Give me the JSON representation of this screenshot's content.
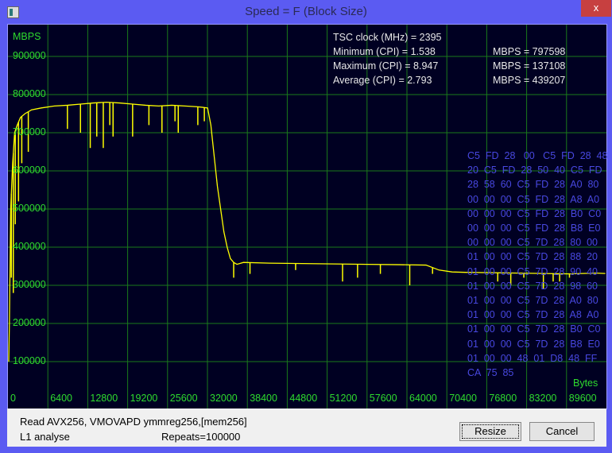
{
  "window": {
    "title": "Speed = F (Block Size)",
    "close_label": "x"
  },
  "chart_data": {
    "type": "line",
    "title": "Speed = F (Block Size)",
    "ylabel": "MBPS",
    "xlabel": "Bytes",
    "ylim": [
      0,
      1000000
    ],
    "xlim": [
      0,
      92000
    ],
    "yticks": [
      "900000",
      "800000",
      "700000",
      "600000",
      "500000",
      "400000",
      "300000",
      "200000",
      "100000"
    ],
    "xticks": [
      "0",
      "6400",
      "12800",
      "19200",
      "25600",
      "32000",
      "38400",
      "44800",
      "51200",
      "57600",
      "64000",
      "70400",
      "76800",
      "83200",
      "89600"
    ],
    "grid": true,
    "series": [
      {
        "name": "MBPS",
        "color": "#ffff00",
        "x": [
          0,
          100,
          300,
          600,
          900,
          1300,
          1800,
          2500,
          3500,
          5000,
          7000,
          9000,
          11000,
          13000,
          15000,
          17000,
          19000,
          21000,
          23000,
          25000,
          27000,
          29000,
          30500,
          31000,
          31500,
          32000,
          32500,
          33000,
          33500,
          34000,
          34500,
          35000,
          36000,
          40000,
          45000,
          50000,
          55000,
          60000,
          64000,
          66000,
          68000,
          70000,
          74000,
          78000,
          82000,
          86000,
          90000,
          91500
        ],
        "y": [
          100000,
          200000,
          500000,
          620000,
          700000,
          720000,
          740000,
          750000,
          760000,
          765000,
          770000,
          772000,
          775000,
          778000,
          780000,
          778000,
          775000,
          772000,
          770000,
          772000,
          770000,
          768000,
          765000,
          720000,
          640000,
          560000,
          500000,
          440000,
          400000,
          370000,
          360000,
          355000,
          360000,
          358000,
          357000,
          356000,
          355000,
          354000,
          353000,
          340000,
          335000,
          334000,
          333000,
          332000,
          331000,
          330000,
          332000,
          331000
        ]
      },
      {
        "name": "dips",
        "color": "#ffff00",
        "x": [
          400,
          700,
          1000,
          1500,
          2000,
          3000,
          9000,
          11000,
          12500,
          13500,
          14500,
          15500,
          16000,
          19000,
          21500,
          23500,
          25500,
          26000,
          29000,
          30000,
          34500,
          37000,
          44000,
          51200,
          53500,
          57000,
          61500,
          65000,
          75000,
          77000,
          79000,
          82000,
          83500,
          84500,
          86000
        ],
        "y": [
          320000,
          280000,
          460000,
          520000,
          620000,
          650000,
          710000,
          700000,
          660000,
          690000,
          660000,
          720000,
          690000,
          690000,
          720000,
          700000,
          730000,
          700000,
          720000,
          730000,
          320000,
          330000,
          340000,
          310000,
          320000,
          330000,
          300000,
          330000,
          310000,
          300000,
          320000,
          290000,
          310000,
          310000,
          320000
        ]
      }
    ]
  },
  "stats": {
    "tsc": "TSC clock (MHz)  = 2395",
    "min": "Minimum (CPI) = 1.538",
    "max": "Maximum (CPI) = 8.947",
    "avg": "Average (CPI) = 2.793",
    "min_mbps": "MBPS = 797598",
    "max_mbps": "MBPS = 137108",
    "avg_mbps": "MBPS = 439207"
  },
  "hex_dump": "C5  FD  28   00   C5  FD  28  48\n20  C5  FD  28  50  40  C5  FD\n28  58  60  C5  FD  28  A0  80\n00  00  00  C5  FD  28  A8  A0\n00  00  00  C5  FD  28  B0  C0\n00  00  00  C5  FD  28  B8  E0\n00  00  00  C5  7D  28  80  00\n01  00  00  C5  7D  28  88  20\n01  00  00  C5  7D  28  90  40\n01  00  00  C5  7D  28  98  60\n01  00  00  C5  7D  28  A0  80\n01  00  00  C5  7D  28  A8  A0\n01  00  00  C5  7D  28  B0  C0\n01  00  00  C5  7D  28  B8  E0\n01  00  00  48  01  D8  48  FF\nCA  75  85",
  "footer": {
    "line1": "Read AVX256, VMOVAPD ymmreg256,[mem256]",
    "line2": "L1 analyse",
    "repeats": "Repeats=100000",
    "resize": "Resize",
    "cancel": "Cancel"
  }
}
